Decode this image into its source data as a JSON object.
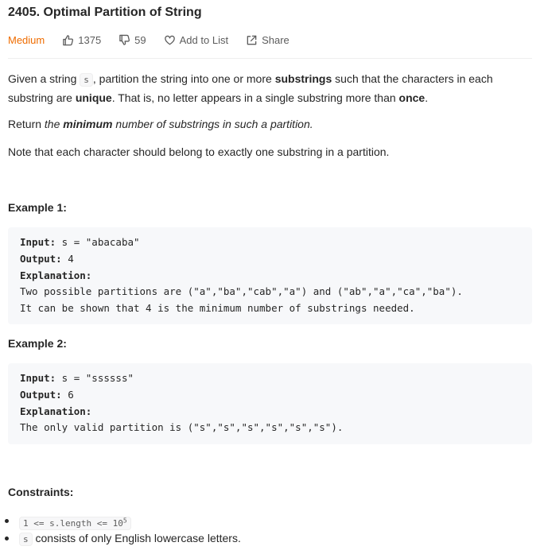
{
  "problem": {
    "title": "2405. Optimal Partition of String",
    "difficulty": "Medium",
    "likes": "1375",
    "dislikes": "59",
    "add_to_list": "Add to List",
    "share": "Share"
  },
  "description": {
    "p1_a": "Given a string ",
    "p1_code": "s",
    "p1_b": ", partition the string into one or more ",
    "p1_bold1": "substrings",
    "p1_c": " such that the characters in each substring are ",
    "p1_bold2": "unique",
    "p1_d": ". That is, no letter appears in a single substring more than ",
    "p1_bold3": "once",
    "p1_e": ".",
    "p2_a": "Return ",
    "p2_b": "the ",
    "p2_bold": "minimum",
    "p2_c": " number of substrings in such a partition.",
    "p3": "Note that each character should belong to exactly one substring in a partition."
  },
  "examples": [
    {
      "heading": "Example 1:",
      "input_label": "Input:",
      "input_value": " s = \"abacaba\"",
      "output_label": "Output:",
      "output_value": " 4",
      "explanation_label": "Explanation:",
      "explanation_line1": "Two possible partitions are (\"a\",\"ba\",\"cab\",\"a\") and (\"ab\",\"a\",\"ca\",\"ba\").",
      "explanation_line2": "It can be shown that 4 is the minimum number of substrings needed."
    },
    {
      "heading": "Example 2:",
      "input_label": "Input:",
      "input_value": " s = \"ssssss\"",
      "output_label": "Output:",
      "output_value": " 6",
      "explanation_label": "Explanation:",
      "explanation_line1": "The only valid partition is (\"s\",\"s\",\"s\",\"s\",\"s\",\"s\")."
    }
  ],
  "constraints": {
    "heading": "Constraints:",
    "c1_code_a": "1 <= s.length <= 10",
    "c1_sup": "5",
    "c2_code": "s",
    "c2_text": " consists of only English lowercase letters."
  },
  "colors": {
    "difficulty_medium": "#ef6c00",
    "text": "#262626",
    "muted": "#5c5c5c",
    "code_bg": "#f7f8fa"
  },
  "icons": [
    "thumbs-up-icon",
    "thumbs-down-icon",
    "heart-icon",
    "share-icon"
  ]
}
